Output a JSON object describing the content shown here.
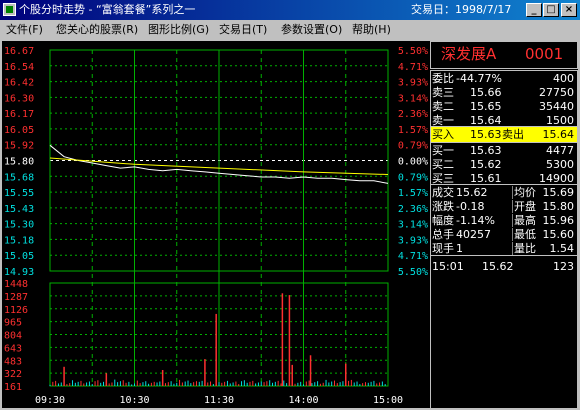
{
  "window": {
    "title": "个股分时走势 - “富翁套餐”系列之一",
    "trade_date_label": "交易日：1998/7/17",
    "minimize_label": "_",
    "maximize_label": "□",
    "close_label": "×"
  },
  "menu": [
    "文件(F)",
    "您关心的股票(R)",
    "图形比例(G)",
    "交易日(T)",
    "参数设置(O)",
    "帮助(H)"
  ],
  "colors": {
    "up": "#ff3030",
    "down": "#00e0e0",
    "grid": "#00b000",
    "price_line": "#ffffff",
    "avg_line": "#ffff00",
    "highlight": "#ffff00"
  },
  "stock": {
    "name": "深发展A",
    "code": "0001"
  },
  "quote": {
    "weibi": {
      "label": "委比",
      "value": "-44.77%",
      "amount": "400"
    },
    "sells": [
      {
        "label": "卖三",
        "price": "15.66",
        "volume": "27750"
      },
      {
        "label": "卖二",
        "price": "15.65",
        "volume": "35440"
      },
      {
        "label": "卖一",
        "price": "15.64",
        "volume": "1500"
      }
    ],
    "buy_in": {
      "label": "买入",
      "price": "15.63",
      "label2": "卖出",
      "price2": "15.64"
    },
    "buys": [
      {
        "label": "买一",
        "price": "15.63",
        "volume": "4477"
      },
      {
        "label": "买二",
        "price": "15.62",
        "volume": "5300"
      },
      {
        "label": "买三",
        "price": "15.61",
        "volume": "14900"
      }
    ],
    "stats": [
      {
        "l1": "成交",
        "v1": "15.62",
        "l2": "均价",
        "v2": "15.69"
      },
      {
        "l1": "涨跌",
        "v1": "-0.18",
        "l2": "开盘",
        "v2": "15.80"
      },
      {
        "l1": "幅度",
        "v1": "-1.14%",
        "l2": "最高",
        "v2": "15.96"
      },
      {
        "l1": "总手",
        "v1": "40257",
        "l2": "最低",
        "v2": "15.60"
      },
      {
        "l1": "现手",
        "v1": "1",
        "l2": "量比",
        "v2": "1.54"
      }
    ],
    "tick": {
      "time": "15:01",
      "price": "15.62",
      "volume": "123"
    }
  },
  "chart_data": {
    "type": "line",
    "prev_close": 15.8,
    "price_ticks": [
      "16.67",
      "16.54",
      "16.42",
      "16.30",
      "16.17",
      "16.05",
      "15.92",
      "15.80",
      "15.68",
      "15.55",
      "15.43",
      "15.30",
      "15.18",
      "15.05",
      "14.93"
    ],
    "pct_ticks": [
      "5.50%",
      "4.71%",
      "3.93%",
      "3.14%",
      "2.36%",
      "1.57%",
      "0.79%",
      "0.00%",
      "0.79%",
      "1.57%",
      "2.36%",
      "3.14%",
      "3.93%",
      "4.71%",
      "5.50%"
    ],
    "ylim": [
      14.93,
      16.67
    ],
    "volume_ticks": [
      "1448",
      "1287",
      "1126",
      "965",
      "804",
      "643",
      "483",
      "322",
      "161"
    ],
    "volume_max": 1609,
    "x_ticks": [
      "09:30",
      "10:30",
      "11:30",
      "14:00",
      "15:00"
    ],
    "series": [
      {
        "type": "line",
        "x": [
          "09:30",
          "09:40",
          "09:50",
          "10:00",
          "10:10",
          "10:20",
          "10:30",
          "10:40",
          "10:50",
          "11:00",
          "11:10",
          "11:20",
          "11:30",
          "13:10",
          "13:20",
          "13:30",
          "13:40",
          "13:50",
          "14:00",
          "14:10",
          "14:20",
          "14:30",
          "14:40",
          "14:50",
          "15:00"
        ],
        "values": [
          15.92,
          15.83,
          15.8,
          15.78,
          15.76,
          15.74,
          15.75,
          15.73,
          15.72,
          15.73,
          15.72,
          15.71,
          15.7,
          15.69,
          15.68,
          15.67,
          15.67,
          15.66,
          15.67,
          15.66,
          15.66,
          15.65,
          15.64,
          15.64,
          15.62
        ]
      },
      {
        "type": "line",
        "x": [
          "09:30",
          "10:30",
          "11:30",
          "14:00",
          "15:00"
        ],
        "values": [
          15.82,
          15.77,
          15.74,
          15.71,
          15.69
        ]
      }
    ],
    "volume_spikes": [
      {
        "time": "09:40",
        "value": 300
      },
      {
        "time": "10:10",
        "value": 200
      },
      {
        "time": "10:50",
        "value": 250
      },
      {
        "time": "11:20",
        "value": 420
      },
      {
        "time": "11:28",
        "value": 1126
      },
      {
        "time": "13:45",
        "value": 1448
      },
      {
        "time": "13:50",
        "value": 1420
      },
      {
        "time": "13:52",
        "value": 330
      },
      {
        "time": "14:05",
        "value": 480
      },
      {
        "time": "14:30",
        "value": 350
      }
    ]
  }
}
